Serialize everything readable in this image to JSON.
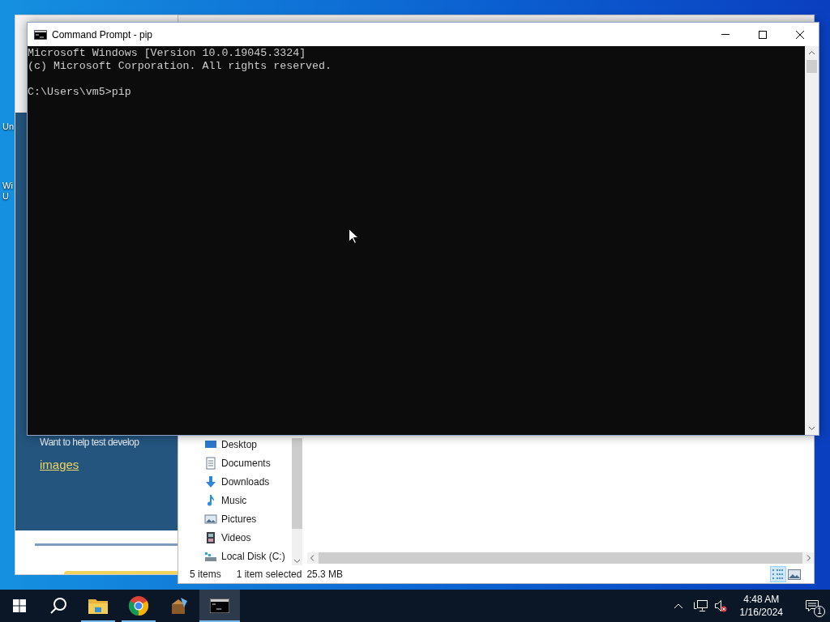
{
  "desktop": {
    "icons": [
      {
        "lines": [
          "Un"
        ]
      },
      {
        "lines": [
          "Wi",
          "U"
        ]
      }
    ]
  },
  "browser": {
    "text": "Want to help test develop",
    "link": "images"
  },
  "explorer": {
    "nav_items": [
      {
        "label": "Desktop",
        "kind": "desktop"
      },
      {
        "label": "Documents",
        "kind": "documents"
      },
      {
        "label": "Downloads",
        "kind": "downloads"
      },
      {
        "label": "Music",
        "kind": "music"
      },
      {
        "label": "Pictures",
        "kind": "pictures"
      },
      {
        "label": "Videos",
        "kind": "videos"
      },
      {
        "label": "Local Disk (C:)",
        "kind": "disk"
      }
    ],
    "status": {
      "count": "5 items",
      "selection": "1 item selected",
      "size": "25.3 MB"
    },
    "views": [
      {
        "kind": "details",
        "selected": true
      },
      {
        "kind": "thumbnails",
        "selected": false
      }
    ]
  },
  "cmd": {
    "title": "Command Prompt - pip",
    "output": [
      "Microsoft Windows [Version 10.0.19045.3324]",
      "(c) Microsoft Corporation. All rights reserved."
    ],
    "prompt": "C:\\Users\\vm5>pip"
  },
  "taskbar": {
    "apps": [
      {
        "kind": "explorer",
        "running": true,
        "selected": false
      },
      {
        "kind": "chrome",
        "running": true,
        "selected": false
      },
      {
        "kind": "installer",
        "running": false,
        "selected": false
      },
      {
        "kind": "cmd",
        "running": true,
        "selected": true
      }
    ],
    "tray": {
      "muted": true,
      "time": "4:48 AM",
      "date": "1/16/2024",
      "notifications": "1"
    }
  }
}
